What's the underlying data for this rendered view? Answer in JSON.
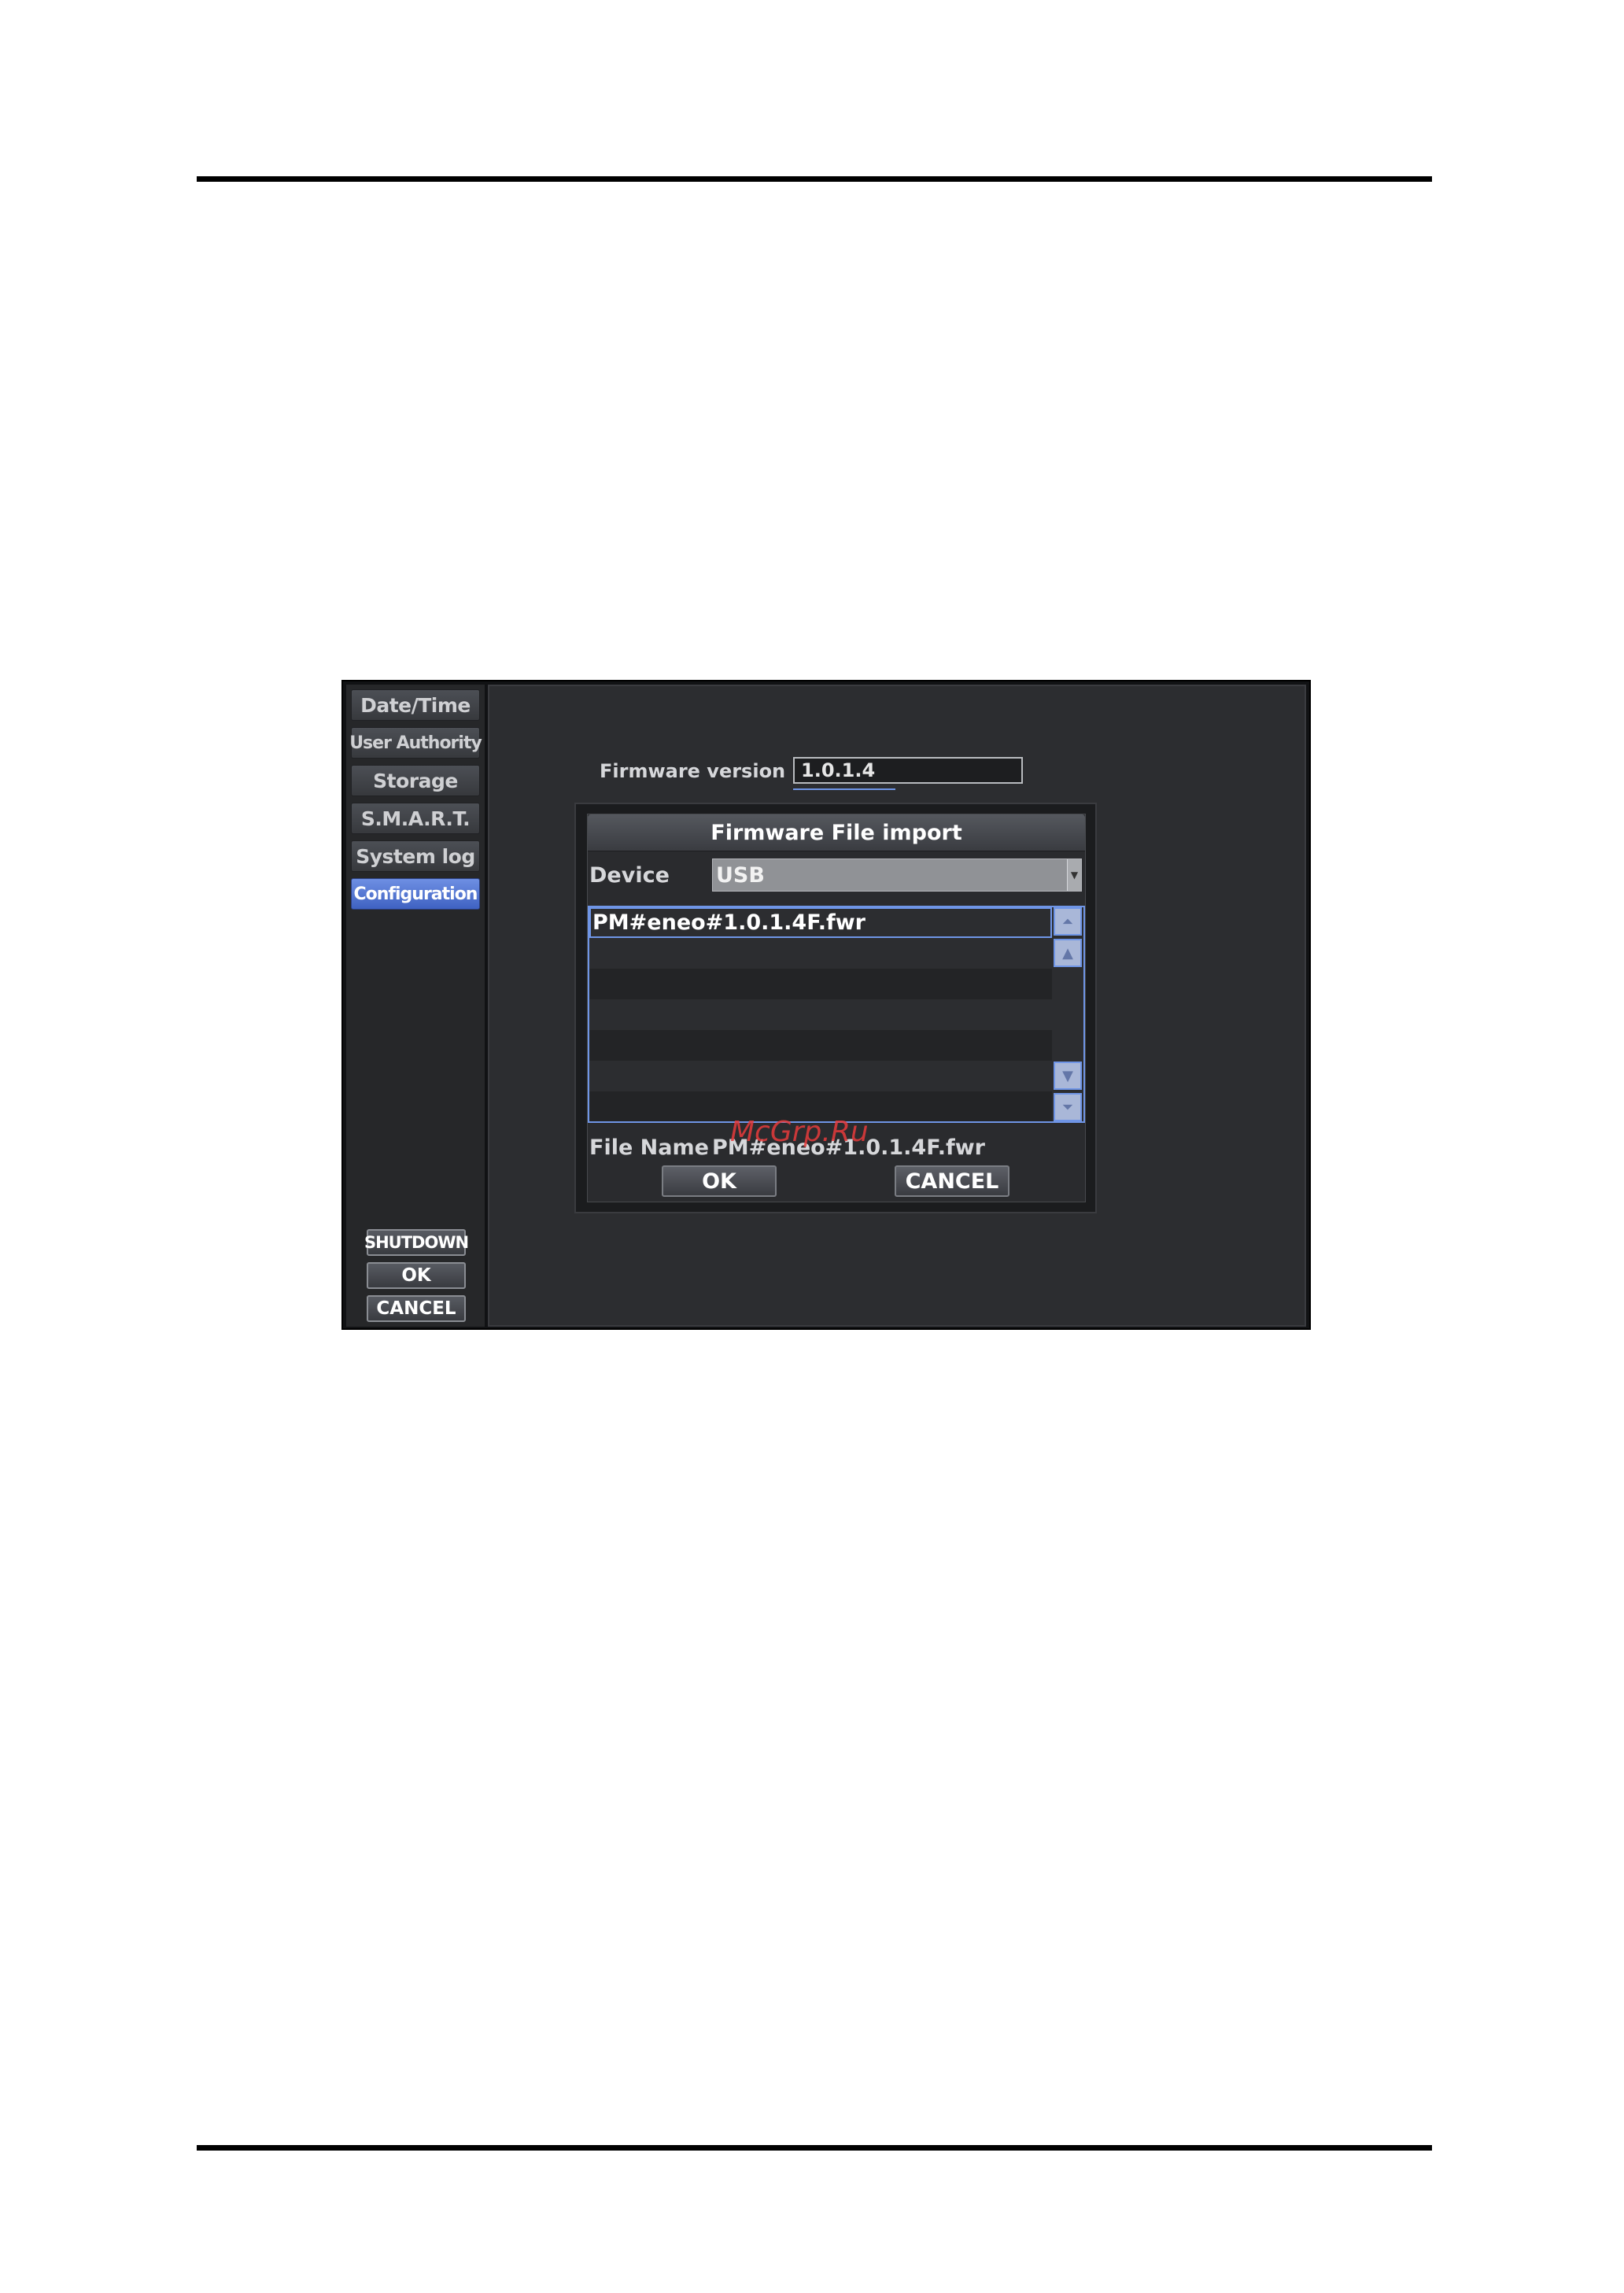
{
  "sidebar": {
    "items": [
      {
        "label": "Date/Time",
        "active": false
      },
      {
        "label": "User Authority",
        "active": false
      },
      {
        "label": "Storage",
        "active": false
      },
      {
        "label": "S.M.A.R.T.",
        "active": false
      },
      {
        "label": "System log",
        "active": false
      },
      {
        "label": "Configuration",
        "active": true
      }
    ],
    "shutdown_label": "SHUTDOWN",
    "ok_label": "OK",
    "cancel_label": "CANCEL"
  },
  "main": {
    "firmware_version_label": "Firmware version",
    "firmware_version_value": "1.0.1.4"
  },
  "dialog": {
    "title": "Firmware File import",
    "device_label": "Device",
    "device_value": "USB",
    "files": [
      "PM#eneo#1.0.1.4F.fwr"
    ],
    "file_name_label": "File Name",
    "file_name_value": "PM#eneo#1.0.1.4F.fwr",
    "ok_label": "OK",
    "cancel_label": "CANCEL"
  },
  "watermark": "McGrp.Ru",
  "colors": {
    "accent": "#6f95e6",
    "active_nav": "#4f72d0",
    "panel_bg": "#2c2d30"
  }
}
